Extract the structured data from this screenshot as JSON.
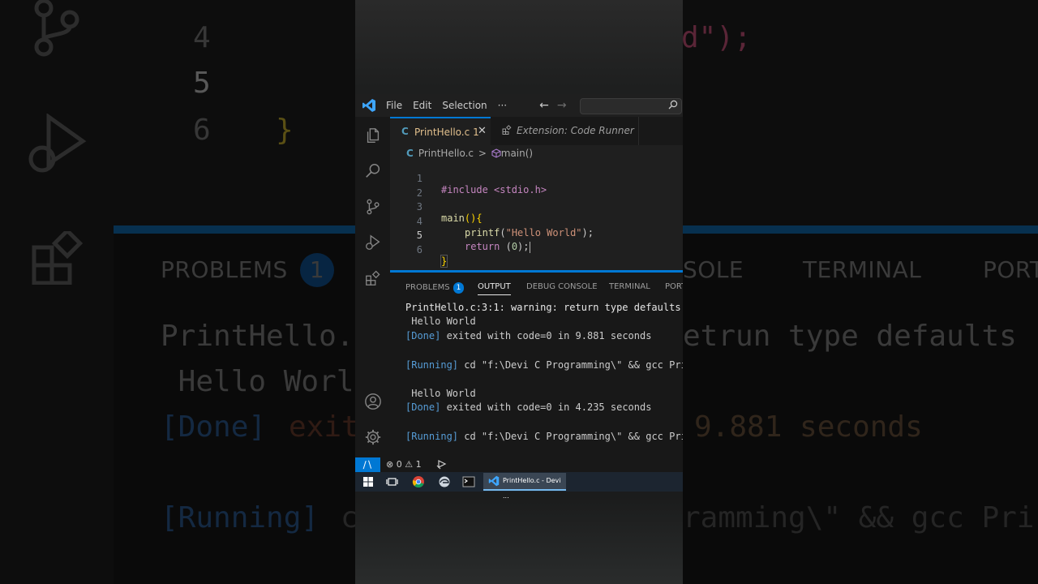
{
  "titlebar": {
    "menus": [
      "File",
      "Edit",
      "Selection",
      "···"
    ]
  },
  "editor": {
    "tabs": [
      {
        "label": "PrintHello.c",
        "problems": "1"
      },
      {
        "label": "Extension: Code Runner"
      }
    ],
    "breadcrumb": {
      "file": "PrintHello.c",
      "separator": ">",
      "symbol": "main()"
    },
    "lines": [
      {
        "n": "1",
        "text": "#include <stdio.h>"
      },
      {
        "n": "2",
        "text": ""
      },
      {
        "n": "3",
        "fn": "main",
        "open": "(){"
      },
      {
        "n": "4",
        "fn": "printf",
        "pre": "(",
        "str": "\"Hello World\"",
        "post": ");"
      },
      {
        "n": "5",
        "kw": "return",
        "pre": " (",
        "num": "0",
        "post": ");"
      },
      {
        "n": "6",
        "close": "}"
      }
    ]
  },
  "panel": {
    "tabs": [
      "PROBLEMS",
      "OUTPUT",
      "DEBUG CONSOLE",
      "TERMINAL",
      "PORT"
    ],
    "problems_count": "1",
    "active_tab": "OUTPUT",
    "output": [
      {
        "text": "PrintHello.c:3:1: warning: return type defaults"
      },
      {
        "text": " Hello World"
      },
      {
        "tag": "[Done]",
        "text": " exited with code=0 in 9.881 seconds"
      },
      {
        "tag": "[Running]",
        "text": " cd \"f:\\Devi C Programming\\\" && gcc Pri"
      },
      {
        "text": " Hello World"
      },
      {
        "tag": "[Done]",
        "text": " exited with code=0 in 4.235 seconds"
      },
      {
        "tag": "[Running]",
        "text": " cd \"f:\\Devi C Programming\\\" && gcc Pri"
      }
    ]
  },
  "statusbar": {
    "errors": "0",
    "warnings": "1"
  },
  "taskbar": {
    "active_app": "PrintHello.c - Devi ..."
  },
  "background": {
    "line_numbers": [
      "4",
      "5",
      "6"
    ],
    "code_fragment": "d\");",
    "brace": "}",
    "tabs": [
      "PROBLEMS",
      "1",
      "SOLE",
      "TERMINAL",
      "PORT"
    ],
    "lines": [
      "PrintHello.",
      "etrun type defaults",
      " Hello Worl",
      "[Done]",
      "exit",
      "9.881 seconds",
      "[Running]",
      "c",
      "ramming\\\" && gcc Pri"
    ]
  },
  "colors": {
    "accent": "#0078d4",
    "editor_bg": "#1f1f1f",
    "panel_bg": "#181818"
  }
}
